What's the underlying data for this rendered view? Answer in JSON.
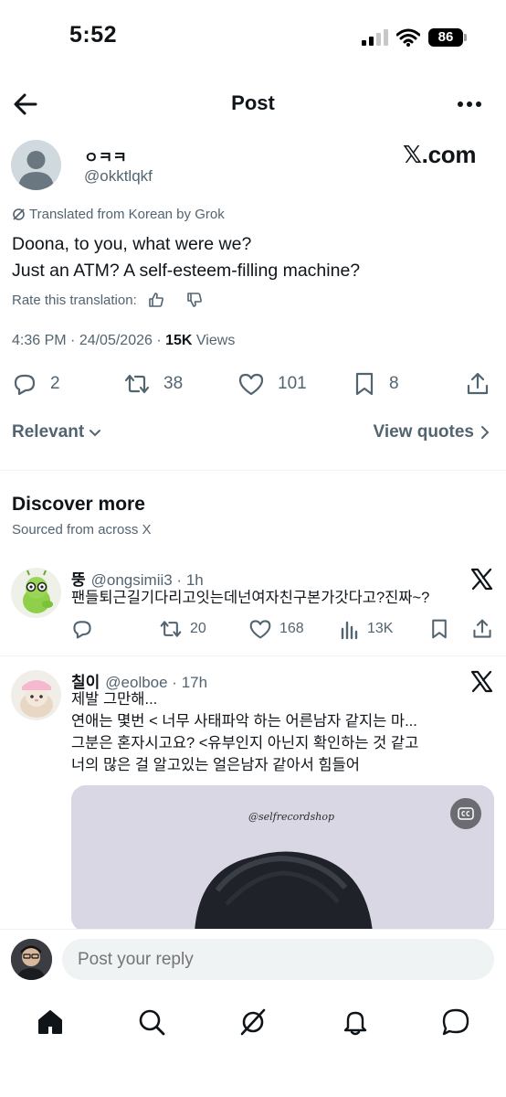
{
  "status_bar": {
    "time": "5:52",
    "battery": "86"
  },
  "header": {
    "title": "Post"
  },
  "post": {
    "display_name": "ㅇㅋㅋ",
    "handle": "@okktlqkf",
    "logo_text": "𝕏.com",
    "translated_label": "Translated from Korean by Grok",
    "text_lines": [
      "Doona, to you, what were we?",
      "Just an ATM? A self-esteem-filling machine?"
    ],
    "rate_label": "Rate this translation:",
    "time": "4:36 PM",
    "date": "24/05/2026",
    "views_count": "15K",
    "views_label": "Views",
    "replies": "2",
    "reposts": "38",
    "likes": "101",
    "bookmarks": "8"
  },
  "sort": {
    "relevant": "Relevant",
    "view_quotes": "View quotes"
  },
  "discover": {
    "title": "Discover more",
    "subtitle": "Sourced from across X",
    "items": [
      {
        "name": "뚱",
        "meta": "@ongsimii3 · 1h",
        "lines": [
          "팬들퇴근길기다리고잇는데넌여자친구본가갓다고?진짜~?"
        ],
        "reposts": "20",
        "likes": "168",
        "views": "13K"
      },
      {
        "name": "칠이",
        "meta": "@eolboe · 17h",
        "lines": [
          "제발 그만해...",
          "연애는 몇번 < 너무 사태파악 하는 어른남자 같지는 마...",
          "그분은 혼자시고요? <유부인지 아닌지 확인하는 것 같고",
          "너의 많은 걸 알고있는 얼은남자 같아서 힘들어"
        ],
        "watermark": "@selfrecordshop"
      }
    ]
  },
  "reply": {
    "placeholder": "Post your reply"
  },
  "colors": {
    "text": "#0f1419",
    "secondary": "#536471",
    "divider": "#eff3f4"
  },
  "icons": [
    "back-arrow-icon",
    "more-icon",
    "translate-icon",
    "thumbs-up-icon",
    "thumbs-down-icon",
    "reply-icon",
    "repost-icon",
    "like-icon",
    "bookmark-icon",
    "share-icon",
    "views-icon",
    "x-logo-icon",
    "home-icon",
    "search-icon",
    "grok-icon",
    "bell-icon",
    "messages-icon"
  ]
}
